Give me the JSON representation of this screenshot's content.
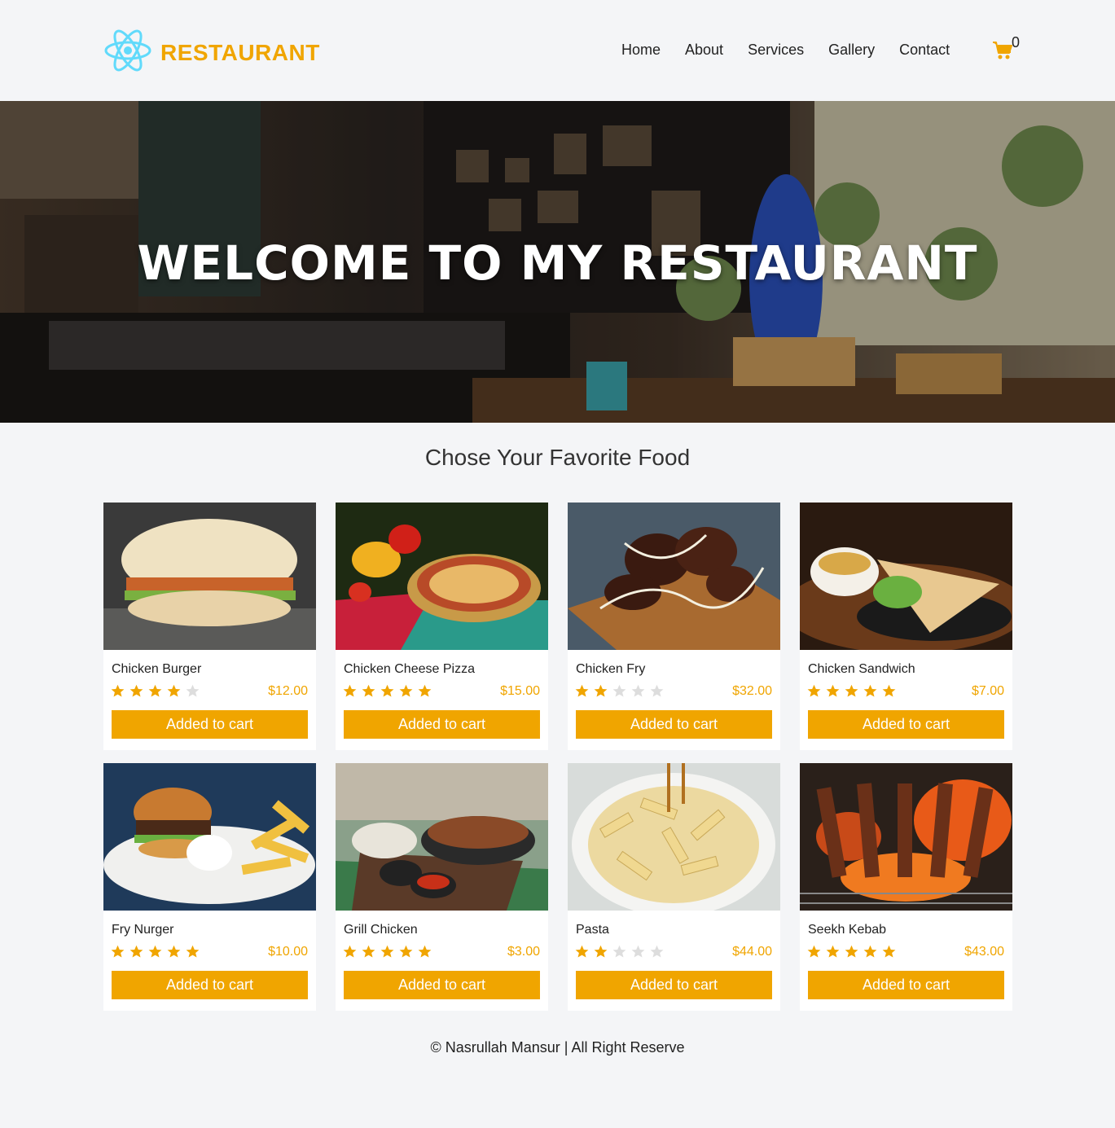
{
  "brand": {
    "name": "RESTAURANT",
    "accent": "#f0a500",
    "logo_icon": "react-atom-icon"
  },
  "nav": {
    "items": [
      "Home",
      "About",
      "Services",
      "Gallery",
      "Contact"
    ]
  },
  "cart": {
    "icon": "shopping-cart-icon",
    "count": "0"
  },
  "hero": {
    "title": "WELCOME TO MY RESTAURANT"
  },
  "section": {
    "title": "Chose Your Favorite Food"
  },
  "foods": [
    {
      "name": "Chicken Burger",
      "price": "$12.00",
      "rating": 4,
      "button": "Added to cart"
    },
    {
      "name": "Chicken Cheese Pizza",
      "price": "$15.00",
      "rating": 5,
      "button": "Added to cart"
    },
    {
      "name": "Chicken Fry",
      "price": "$32.00",
      "rating": 2,
      "button": "Added to cart"
    },
    {
      "name": "Chicken Sandwich",
      "price": "$7.00",
      "rating": 5,
      "button": "Added to cart"
    },
    {
      "name": "Fry Nurger",
      "price": "$10.00",
      "rating": 5,
      "button": "Added to cart"
    },
    {
      "name": "Grill Chicken",
      "price": "$3.00",
      "rating": 5,
      "button": "Added to cart"
    },
    {
      "name": "Pasta",
      "price": "$44.00",
      "rating": 2,
      "button": "Added to cart"
    },
    {
      "name": "Seekh Kebab",
      "price": "$43.00",
      "rating": 5,
      "button": "Added to cart"
    }
  ],
  "footer": {
    "text": "© Nasrullah Mansur | All Right Reserve"
  }
}
